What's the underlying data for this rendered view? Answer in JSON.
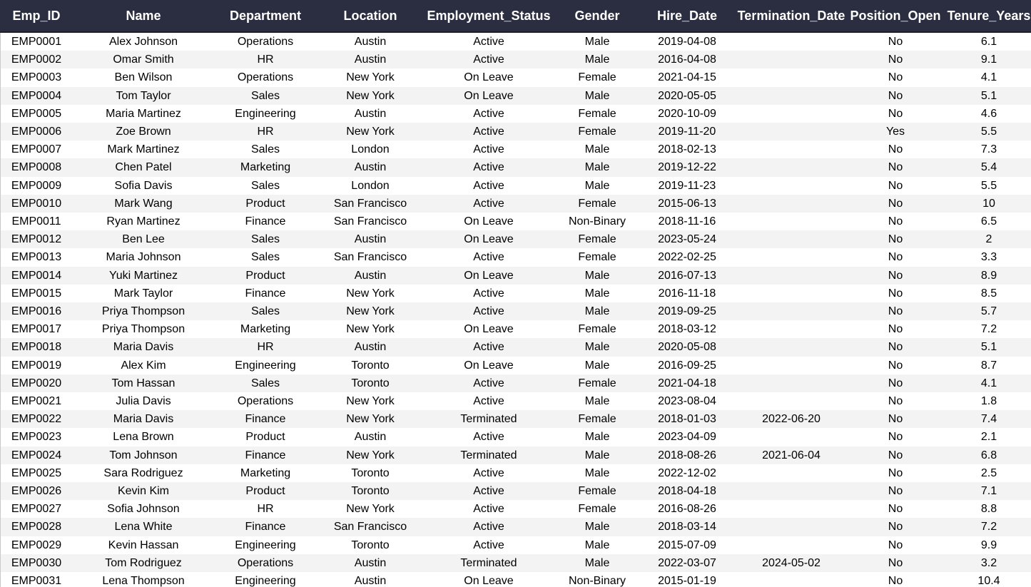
{
  "table": {
    "columns": [
      "Emp_ID",
      "Name",
      "Department",
      "Location",
      "Employment_Status",
      "Gender",
      "Hire_Date",
      "Termination_Date",
      "Position_Open",
      "Tenure_Years"
    ],
    "rows": [
      [
        "EMP0001",
        "Alex Johnson",
        "Operations",
        "Austin",
        "Active",
        "Male",
        "2019-04-08",
        "",
        "No",
        "6.1"
      ],
      [
        "EMP0002",
        "Omar Smith",
        "HR",
        "Austin",
        "Active",
        "Male",
        "2016-04-08",
        "",
        "No",
        "9.1"
      ],
      [
        "EMP0003",
        "Ben Wilson",
        "Operations",
        "New York",
        "On Leave",
        "Female",
        "2021-04-15",
        "",
        "No",
        "4.1"
      ],
      [
        "EMP0004",
        "Tom Taylor",
        "Sales",
        "New York",
        "On Leave",
        "Male",
        "2020-05-05",
        "",
        "No",
        "5.1"
      ],
      [
        "EMP0005",
        "Maria Martinez",
        "Engineering",
        "Austin",
        "Active",
        "Female",
        "2020-10-09",
        "",
        "No",
        "4.6"
      ],
      [
        "EMP0006",
        "Zoe Brown",
        "HR",
        "New York",
        "Active",
        "Female",
        "2019-11-20",
        "",
        "Yes",
        "5.5"
      ],
      [
        "EMP0007",
        "Mark Martinez",
        "Sales",
        "London",
        "Active",
        "Male",
        "2018-02-13",
        "",
        "No",
        "7.3"
      ],
      [
        "EMP0008",
        "Chen Patel",
        "Marketing",
        "Austin",
        "Active",
        "Male",
        "2019-12-22",
        "",
        "No",
        "5.4"
      ],
      [
        "EMP0009",
        "Sofia Davis",
        "Sales",
        "London",
        "Active",
        "Male",
        "2019-11-23",
        "",
        "No",
        "5.5"
      ],
      [
        "EMP0010",
        "Mark Wang",
        "Product",
        "San Francisco",
        "Active",
        "Female",
        "2015-06-13",
        "",
        "No",
        "10"
      ],
      [
        "EMP0011",
        "Ryan Martinez",
        "Finance",
        "San Francisco",
        "On Leave",
        "Non-Binary",
        "2018-11-16",
        "",
        "No",
        "6.5"
      ],
      [
        "EMP0012",
        "Ben Lee",
        "Sales",
        "Austin",
        "On Leave",
        "Female",
        "2023-05-24",
        "",
        "No",
        "2"
      ],
      [
        "EMP0013",
        "Maria Johnson",
        "Sales",
        "San Francisco",
        "Active",
        "Female",
        "2022-02-25",
        "",
        "No",
        "3.3"
      ],
      [
        "EMP0014",
        "Yuki Martinez",
        "Product",
        "Austin",
        "On Leave",
        "Male",
        "2016-07-13",
        "",
        "No",
        "8.9"
      ],
      [
        "EMP0015",
        "Mark Taylor",
        "Finance",
        "New York",
        "Active",
        "Male",
        "2016-11-18",
        "",
        "No",
        "8.5"
      ],
      [
        "EMP0016",
        "Priya Thompson",
        "Sales",
        "New York",
        "Active",
        "Male",
        "2019-09-25",
        "",
        "No",
        "5.7"
      ],
      [
        "EMP0017",
        "Priya Thompson",
        "Marketing",
        "New York",
        "On Leave",
        "Female",
        "2018-03-12",
        "",
        "No",
        "7.2"
      ],
      [
        "EMP0018",
        "Maria Davis",
        "HR",
        "Austin",
        "Active",
        "Male",
        "2020-05-08",
        "",
        "No",
        "5.1"
      ],
      [
        "EMP0019",
        "Alex Kim",
        "Engineering",
        "Toronto",
        "On Leave",
        "Male",
        "2016-09-25",
        "",
        "No",
        "8.7"
      ],
      [
        "EMP0020",
        "Tom Hassan",
        "Sales",
        "Toronto",
        "Active",
        "Female",
        "2021-04-18",
        "",
        "No",
        "4.1"
      ],
      [
        "EMP0021",
        "Julia Davis",
        "Operations",
        "New York",
        "Active",
        "Male",
        "2023-08-04",
        "",
        "No",
        "1.8"
      ],
      [
        "EMP0022",
        "Maria Davis",
        "Finance",
        "New York",
        "Terminated",
        "Female",
        "2018-01-03",
        "2022-06-20",
        "No",
        "7.4"
      ],
      [
        "EMP0023",
        "Lena Brown",
        "Product",
        "Austin",
        "Active",
        "Male",
        "2023-04-09",
        "",
        "No",
        "2.1"
      ],
      [
        "EMP0024",
        "Tom Johnson",
        "Finance",
        "New York",
        "Terminated",
        "Male",
        "2018-08-26",
        "2021-06-04",
        "No",
        "6.8"
      ],
      [
        "EMP0025",
        "Sara Rodriguez",
        "Marketing",
        "Toronto",
        "Active",
        "Male",
        "2022-12-02",
        "",
        "No",
        "2.5"
      ],
      [
        "EMP0026",
        "Kevin Kim",
        "Product",
        "Toronto",
        "Active",
        "Female",
        "2018-04-18",
        "",
        "No",
        "7.1"
      ],
      [
        "EMP0027",
        "Sofia Johnson",
        "HR",
        "New York",
        "Active",
        "Female",
        "2016-08-26",
        "",
        "No",
        "8.8"
      ],
      [
        "EMP0028",
        "Lena White",
        "Finance",
        "San Francisco",
        "Active",
        "Male",
        "2018-03-14",
        "",
        "No",
        "7.2"
      ],
      [
        "EMP0029",
        "Kevin Hassan",
        "Engineering",
        "Toronto",
        "Active",
        "Male",
        "2015-07-09",
        "",
        "No",
        "9.9"
      ],
      [
        "EMP0030",
        "Tom Rodriguez",
        "Operations",
        "Austin",
        "Terminated",
        "Male",
        "2022-03-07",
        "2024-05-02",
        "No",
        "3.2"
      ],
      [
        "EMP0031",
        "Lena Thompson",
        "Engineering",
        "Austin",
        "On Leave",
        "Non-Binary",
        "2015-01-19",
        "",
        "No",
        "10.4"
      ]
    ]
  },
  "colors": {
    "header_bg": "#2a2e40",
    "header_text": "#ffffff",
    "row_alt_bg": "#f3f3f3",
    "row_bg": "#ffffff"
  }
}
